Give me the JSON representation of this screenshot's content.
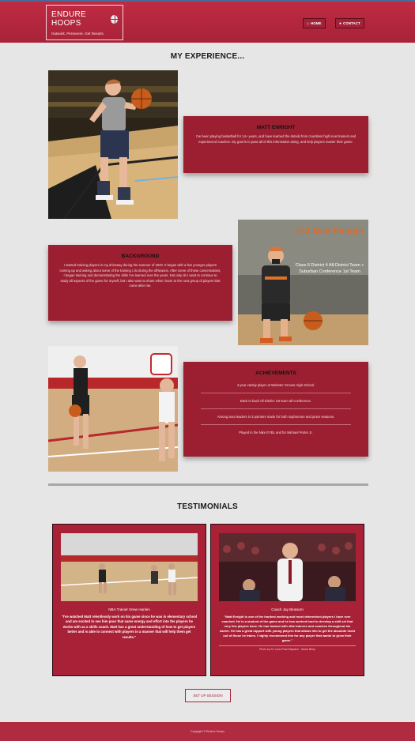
{
  "header": {
    "brand": "ENDURE HOOPS",
    "tagline": "Outwork. Persevere. Get Results.",
    "nav": [
      {
        "label": "HOME",
        "icon": "home-icon"
      },
      {
        "label": "CONTACT",
        "icon": "person-icon"
      }
    ]
  },
  "experience": {
    "title": "MY EXPERIENCE...",
    "bio": {
      "title": "MATT ENRIGHT",
      "text": "I've been playing basketball for 14+ years, and have learned the details from countless high level trainers and experienced coaches. My goal is to pass all of this information along, and help players master their game."
    },
    "background": {
      "title": "BACKGROUND",
      "text": "I started training players in my driveway during the summer of 2020. It began with a few younger players coming up and asking about some of the training I do during the offseason. After some of these conversations, I began training and demonstrating the drills I've learned over the years. Not only do I want to continue to study all aspects of the game for myself, but I also want to share what I learn to the next group of players that come after me."
    },
    "poster": {
      "headline": "#13 Matt Enright",
      "caption": "Class 6 District 4 All-District Team + Suburban Conference 1st Team"
    },
    "achievements": {
      "title": "ACHIEVEMENTS",
      "items": [
        "4 year varsity player at Webster Groves High School.",
        "Back to back All District 1st team all Conference.",
        "Among area leaders in 3 pointers made for both sophomore and junior seasons.",
        "Played in the Nike EYBL and for Michael Porter Jr."
      ]
    }
  },
  "testimonials": {
    "title": "TESTIMONIALS",
    "items": [
      {
        "name": "NBA Trainer Drew Hanlen",
        "quote": "\"I've watched Matt relentlessly work on his game since he was in elementary school and am excited to see him pour that same energy and effort into the players he works with as a skills coach. Matt has a great understanding of how to get players better and is able to connect with players in a manner that will help them get results.\"",
        "credit": ""
      },
      {
        "name": "Coach Jay Blossom",
        "quote": "\"Matt Enright is one of the hardest working and most determined players I have ever coached. He is a student of the game and he has worked hard to develop a skill set that very few players have. He has trained with elite trainers and coaches throughout his career. He has a great rapport with young players that allows him to get the absolute most out of those he trains. I highly recommend him for any player that wants to grow their game.\"",
        "credit": "Photo by St. Louis Post-Dispatch - Sarah Berry"
      }
    ]
  },
  "cta": {
    "label": "SET UP SESSION"
  },
  "footer": {
    "text": "Copyright © Endure Hoops"
  },
  "colors": {
    "brand": "#b02a40",
    "card": "#9b1f30",
    "background": "#e6e6e6"
  }
}
